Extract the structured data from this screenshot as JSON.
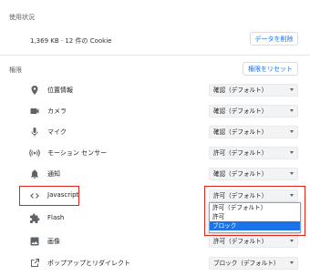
{
  "usage": {
    "section_title": "使用状況",
    "summary": "1,369 KB · 12 件の Cookie",
    "clear_button": "データを削除"
  },
  "permissions": {
    "section_title": "権限",
    "reset_button": "権限をリセット",
    "items": [
      {
        "icon": "location-pin-icon",
        "label": "位置情報",
        "value": "確認（デフォルト）"
      },
      {
        "icon": "camera-icon",
        "label": "カメラ",
        "value": "確認（デフォルト）"
      },
      {
        "icon": "microphone-icon",
        "label": "マイク",
        "value": "確認（デフォルト）"
      },
      {
        "icon": "motion-sensor-icon",
        "label": "モーション センサー",
        "value": "許可（デフォルト）"
      },
      {
        "icon": "bell-icon",
        "label": "通知",
        "value": "確認（デフォルト）"
      },
      {
        "icon": "code-icon",
        "label": "Javascript",
        "value": "許可（デフォルト）"
      },
      {
        "icon": "puzzle-icon",
        "label": "Flash",
        "value": ""
      },
      {
        "icon": "image-icon",
        "label": "画像",
        "value": "許可（デフォルト）"
      },
      {
        "icon": "popup-icon",
        "label": "ポップアップとリダイレクト",
        "value": "ブロック（デフォルト）"
      }
    ],
    "javascript_dropdown": {
      "options": [
        "許可（デフォルト）",
        "許可",
        "ブロック"
      ],
      "highlighted": "ブロック"
    }
  },
  "colors": {
    "accent": "#1a73e8",
    "highlight_box": "#e0241b"
  }
}
